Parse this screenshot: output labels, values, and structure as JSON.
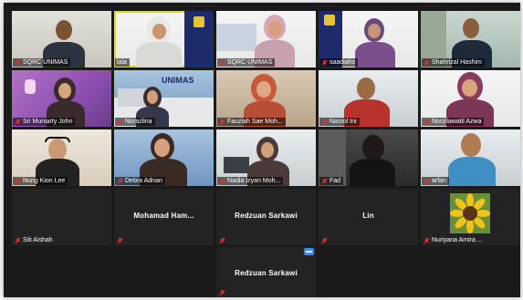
{
  "participants": [
    {
      "name": "SQRC UNIMAS"
    },
    {
      "name": "lala"
    },
    {
      "name": "SQRC UNIMAS"
    },
    {
      "name": "saadiahs"
    },
    {
      "name": "Shahrizal Hashim"
    },
    {
      "name": "Sri  Muniarty John"
    },
    {
      "name": "Norazlina"
    },
    {
      "name": "Fauziah Sae Moh..."
    },
    {
      "name": "Nasrol Ini"
    },
    {
      "name": "Norzilawatil Azwa"
    },
    {
      "name": "Nung Kion Lee"
    },
    {
      "name": "Debra Adnan"
    },
    {
      "name": "Nadia Izyan Moh..."
    },
    {
      "name": "Fad"
    },
    {
      "name": "arfan"
    },
    {
      "name": "Siti Aishah"
    },
    {
      "name": ""
    },
    {
      "name": ""
    },
    {
      "name": ""
    },
    {
      "name": "Nuriyana Amira ..."
    },
    {
      "name": ""
    }
  ],
  "center_names": {
    "mohamad": "Mohamad  Ham...",
    "redzuan1": "Redzuan Sarkawi",
    "lin": "Lin",
    "redzuan2": "Redzuan Sarkawi"
  },
  "logos": {
    "unimas": "UNIMAS"
  },
  "colors": {
    "active_speaker": "#d8e21a",
    "mic_muted": "#e0322b",
    "accent_blue": "#2d8cff"
  }
}
